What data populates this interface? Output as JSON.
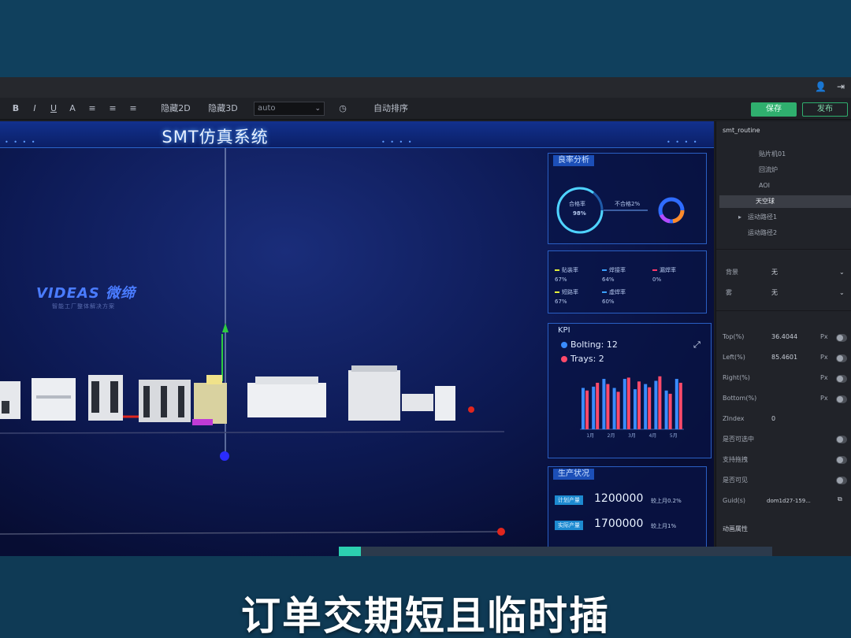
{
  "window": {
    "title_icons": [
      "user-icon",
      "logout-icon"
    ]
  },
  "toolbar": {
    "format_buttons": [
      "B",
      "I",
      "U",
      "A"
    ],
    "view_2d": "隐藏2D",
    "view_3d": "隐藏3D",
    "select_value": "auto",
    "auto_layout": "自动排序",
    "save_label": "保存",
    "publish_label": "发布"
  },
  "canvas": {
    "header_title": "SMT仿真系统",
    "brand_name": "VIDEAS 微缔",
    "brand_tagline": "智能工厂整体解决方案",
    "panel1": {
      "title": "良率分析",
      "ring_label": "合格率",
      "ring_value": "98%",
      "side_label": "不合格2%"
    },
    "panel2": {
      "items": [
        {
          "label": "贴装率",
          "value": "67%",
          "color": "#e3f03a"
        },
        {
          "label": "焊接率",
          "value": "64%",
          "color": "#3aa0ff"
        },
        {
          "label": "漏焊率",
          "value": "0%",
          "color": "#ff3a6a"
        },
        {
          "label": "短路率",
          "value": "67%",
          "color": "#e3f03a"
        },
        {
          "label": "虚焊率",
          "value": "60%",
          "color": "#3aa0ff"
        }
      ]
    },
    "panel3": {
      "title": "KPI",
      "legend": [
        {
          "label": "Bolting: 12",
          "color": "#3a8cff"
        },
        {
          "label": "Trays: 2",
          "color": "#ff4a6a"
        }
      ]
    },
    "panel4": {
      "title": "生产状况",
      "rows": [
        {
          "label": "计划产量",
          "value": "1200000",
          "note": "较上月0.2%"
        },
        {
          "label": "实际产量",
          "value": "1700000",
          "note": "较上月1%"
        }
      ]
    }
  },
  "chart_data": {
    "type": "bar",
    "categories": [
      "1月",
      "2月",
      "3月",
      "4月",
      "5月"
    ],
    "series": [
      {
        "name": "Bolting",
        "values": [
          64,
          66,
          78,
          64,
          78,
          62,
          70,
          75,
          60,
          78
        ]
      },
      {
        "name": "Trays",
        "values": [
          60,
          72,
          70,
          58,
          80,
          74,
          65,
          82,
          55,
          72
        ]
      }
    ],
    "ylim": [
      0,
      100
    ]
  },
  "sidebar": {
    "tree_root": "smt_routine",
    "tree_items": [
      "贴片机01",
      "回流炉",
      "AOI",
      "天空球",
      "运动路径1",
      "运动路径2"
    ],
    "selected_item": "天空球",
    "prop_rows": [
      {
        "label": "背景",
        "value": "无"
      },
      {
        "label": "雾",
        "value": "无"
      }
    ],
    "num_rows": [
      {
        "label": "Top(%)",
        "value": "36.4044",
        "unit": "Px"
      },
      {
        "label": "Left(%)",
        "value": "85.4601",
        "unit": "Px"
      },
      {
        "label": "Right(%)",
        "value": "",
        "unit": "Px"
      },
      {
        "label": "Bottom(%)",
        "value": "",
        "unit": "Px"
      }
    ],
    "zindex": {
      "label": "ZIndex",
      "value": "0"
    },
    "toggles": [
      "是否可选中",
      "支持拖拽",
      "是否可见"
    ],
    "guid": {
      "label": "Guid(s)",
      "value": "dom1d27-159..."
    },
    "section": "动画属性"
  },
  "progress": {
    "fraction": 0.05
  },
  "subtitle": "订单交期短且临时插"
}
